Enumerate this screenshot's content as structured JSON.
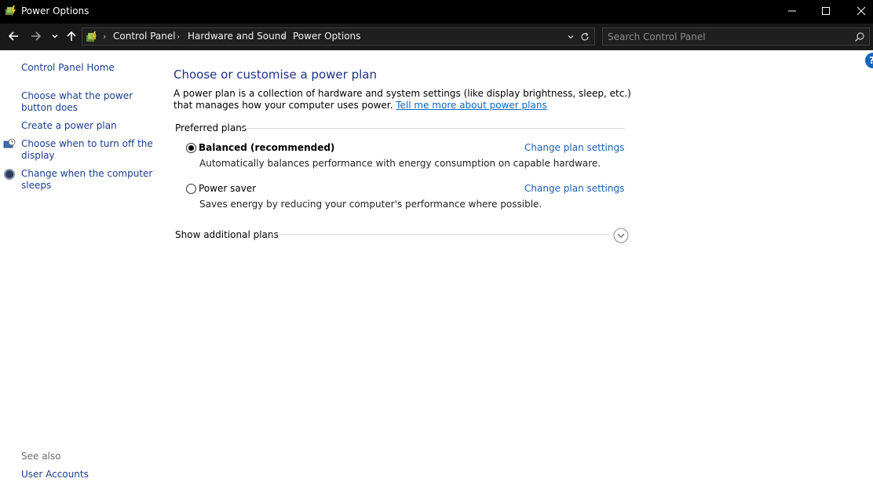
{
  "window": {
    "title": "Power Options",
    "controls": {
      "minimize_icon": "minimize-icon",
      "maximize_icon": "maximize-icon",
      "close_icon": "close-icon"
    }
  },
  "navigation": {
    "back_icon": "arrow-left-icon",
    "forward_icon": "arrow-right-icon",
    "recent_icon": "chevron-down-icon",
    "up_icon": "arrow-up-icon",
    "breadcrumbs": [
      {
        "label": "Control Panel"
      },
      {
        "label": "Hardware and Sound"
      },
      {
        "label": "Power Options"
      }
    ],
    "search": {
      "placeholder": "Search Control Panel",
      "value": ""
    }
  },
  "sidebar": {
    "links": [
      {
        "label": "Control Panel Home"
      },
      {
        "label": "Choose what the power button does"
      },
      {
        "label": "Create a power plan"
      },
      {
        "label": "Choose when to turn off the display",
        "icon": "display-schedule-icon"
      },
      {
        "label": "Change when the computer sleeps",
        "icon": "sleep-moon-icon"
      }
    ],
    "see_also": {
      "heading": "See also",
      "links": [
        {
          "label": "User Accounts"
        }
      ]
    }
  },
  "main": {
    "title": "Choose or customise a power plan",
    "intro_text": "A power plan is a collection of hardware and system settings (like display brightness, sleep, etc.) that manages how your computer uses power.",
    "intro_link": "Tell me more about power plans",
    "preferred_plans_label": "Preferred plans",
    "plans": [
      {
        "name": "Balanced (recommended)",
        "description": "Automatically balances performance with energy consumption on capable hardware.",
        "selected": true,
        "link": "Change plan settings"
      },
      {
        "name": "Power saver",
        "description": "Saves energy by reducing your computer's performance where possible.",
        "selected": false,
        "link": "Change plan settings"
      }
    ],
    "additional_plans_label": "Show additional plans",
    "help_label": "?"
  },
  "colors": {
    "titlebar_bg": "#000000",
    "addressbar_bg": "#191919",
    "link": "#1a5fb4",
    "heading": "#1e3287",
    "help_button": "#1565c0"
  }
}
